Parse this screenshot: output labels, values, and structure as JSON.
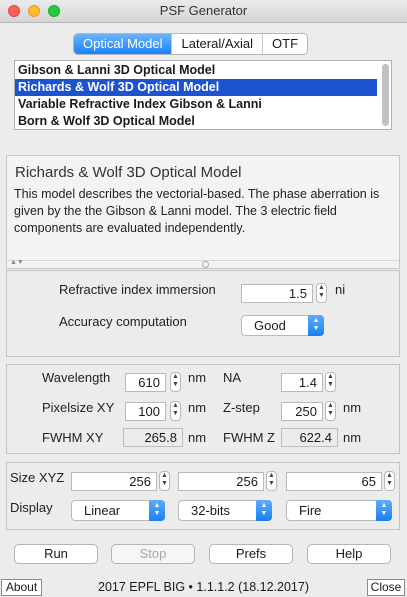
{
  "window": {
    "title": "PSF Generator"
  },
  "tabs": [
    {
      "label": "Optical Model",
      "active": true
    },
    {
      "label": "Lateral/Axial",
      "active": false
    },
    {
      "label": "OTF",
      "active": false
    }
  ],
  "models": [
    {
      "label": "Gibson & Lanni 3D Optical Model",
      "selected": false
    },
    {
      "label": "Richards & Wolf 3D Optical Model",
      "selected": true
    },
    {
      "label": "Variable Refractive Index Gibson & Lanni",
      "selected": false
    },
    {
      "label": "Born & Wolf 3D Optical Model",
      "selected": false
    }
  ],
  "description": {
    "title": "Richards & Wolf 3D Optical Model",
    "body": "This model describes the vectorial-based. The phase aberration is given by the the Gibson & Lanni model. The 3 electric field components are evaluated independently."
  },
  "model_params": {
    "ri_label": "Refractive index immersion",
    "ri_value": "1.5",
    "ri_unit": "ni",
    "accuracy_label": "Accuracy computation",
    "accuracy_value": "Good"
  },
  "optics": {
    "wavelength_label": "Wavelength",
    "wavelength_value": "610",
    "wavelength_unit": "nm",
    "na_label": "NA",
    "na_value": "1.4",
    "pixelsize_label": "Pixelsize XY",
    "pixelsize_value": "100",
    "pixelsize_unit": "nm",
    "zstep_label": "Z-step",
    "zstep_value": "250",
    "zstep_unit": "nm",
    "fwhmxy_label": "FWHM XY",
    "fwhmxy_value": "265.8",
    "fwhmxy_unit": "nm",
    "fwhmz_label": "FWHM Z",
    "fwhmz_value": "622.4",
    "fwhmz_unit": "nm"
  },
  "output": {
    "size_label": "Size XYZ",
    "size_x": "256",
    "size_y": "256",
    "size_z": "65",
    "display_label": "Display",
    "scale": "Linear",
    "bits": "32-bits",
    "lut": "Fire"
  },
  "buttons": {
    "run": "Run",
    "stop": "Stop",
    "prefs": "Prefs",
    "help": "Help"
  },
  "statusbar": {
    "about": "About",
    "text": "2017 EPFL BIG • 1.1.1.2 (18.12.2017)",
    "close": "Close"
  },
  "colors": {
    "accent": "#1a82fb",
    "selection": "#1d53cf"
  }
}
